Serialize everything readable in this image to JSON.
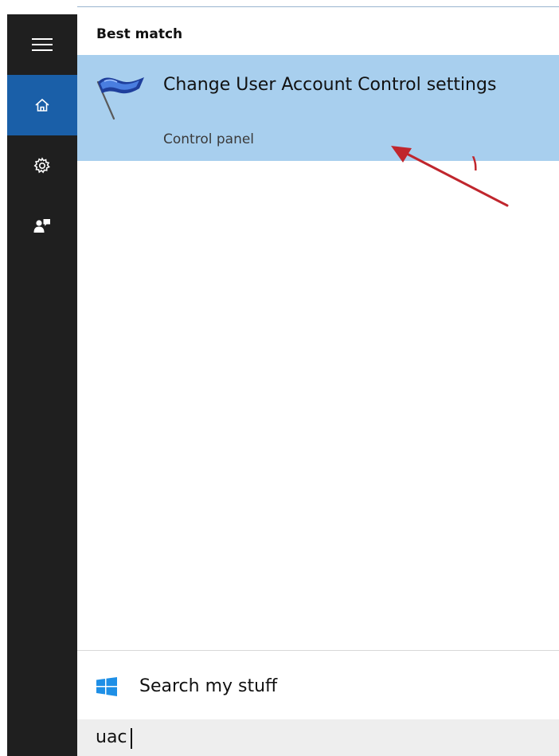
{
  "sidebar": {
    "items": [
      {
        "name": "menu",
        "icon": "hamburger-menu-icon"
      },
      {
        "name": "home",
        "icon": "home-icon",
        "selected": true
      },
      {
        "name": "settings",
        "icon": "gear-icon"
      },
      {
        "name": "feedback",
        "icon": "feedback-icon"
      }
    ]
  },
  "results": {
    "section_label": "Best match",
    "best": {
      "title": "Change User Account Control settings",
      "subtitle": "Control panel",
      "icon": "uac-flag-icon"
    }
  },
  "annotation": {
    "label": "١",
    "color": "#c0262d"
  },
  "search_my_stuff": {
    "label": "Search my stuff",
    "icon": "windows-logo-icon"
  },
  "searchbox": {
    "value": "uac"
  },
  "colors": {
    "sidebar_bg": "#1f1f1f",
    "sidebar_selected": "#1a5fa8",
    "result_highlight": "#a8cfee",
    "windows_blue": "#1e8fe6"
  }
}
